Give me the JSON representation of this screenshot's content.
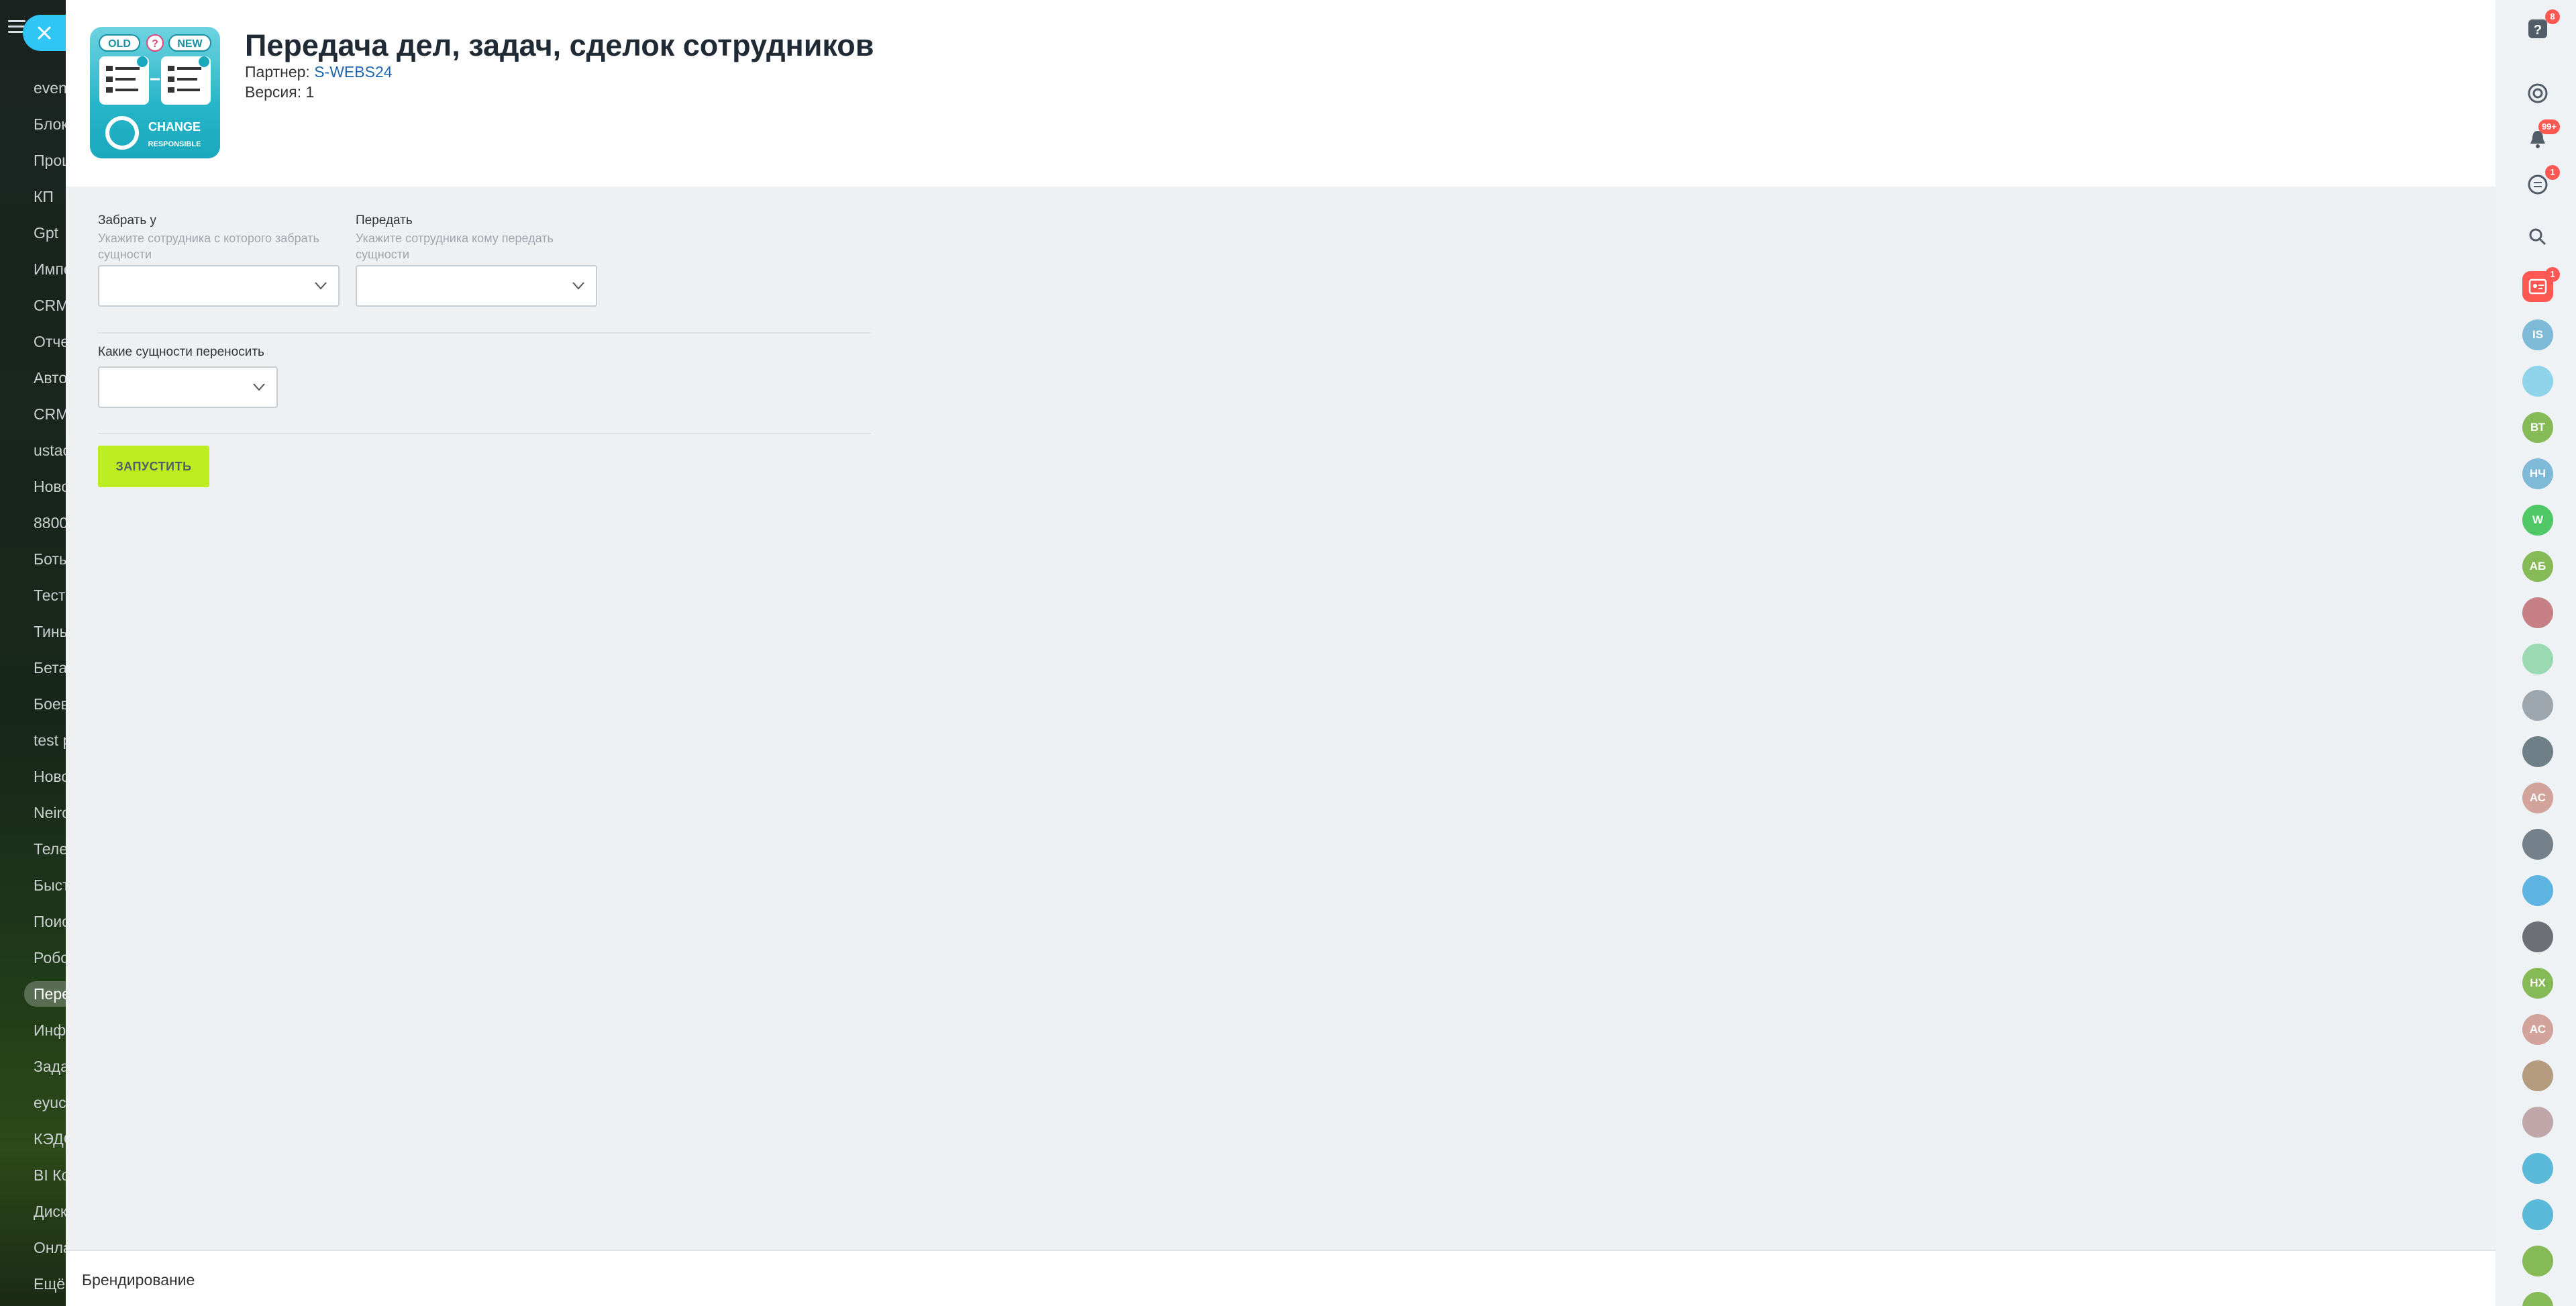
{
  "left_menu": {
    "items": [
      {
        "label": "events"
      },
      {
        "label": "Блоки"
      },
      {
        "label": "Процессы"
      },
      {
        "label": "КП"
      },
      {
        "label": "Gpt"
      },
      {
        "label": "Импорт"
      },
      {
        "label": "CRM"
      },
      {
        "label": "Отчеты"
      },
      {
        "label": "Автоматизация"
      },
      {
        "label": "CRM"
      },
      {
        "label": "ustack"
      },
      {
        "label": "Новости"
      },
      {
        "label": "8800"
      },
      {
        "label": "Боты"
      },
      {
        "label": "Тесты"
      },
      {
        "label": "Тиньков"
      },
      {
        "label": "Бета"
      },
      {
        "label": "Боевой"
      },
      {
        "label": "test p"
      },
      {
        "label": "Новое"
      },
      {
        "label": "Neiro"
      },
      {
        "label": "Телефония"
      },
      {
        "label": "Быстро"
      },
      {
        "label": "Поиск"
      },
      {
        "label": "Роботы"
      },
      {
        "label": "Передача",
        "active": true
      },
      {
        "label": "Информация"
      },
      {
        "label": "Задачи"
      },
      {
        "label": "eyuc"
      },
      {
        "label": "КЭДО"
      },
      {
        "label": "BI Конструктор"
      },
      {
        "label": "Диск"
      },
      {
        "label": "Онлайн"
      },
      {
        "label": "Ещё"
      }
    ]
  },
  "app": {
    "title": "Передача дел, задач, сделок сотрудников",
    "partner_label": "Партнер: ",
    "partner_name": "S-WEBS24",
    "version": "Версия: 1",
    "logo": {
      "old_tag": "OLD",
      "question": "?",
      "new_tag": "NEW",
      "change": "CHANGE",
      "responsible": "RESPONSIBLE"
    }
  },
  "form": {
    "from": {
      "label": "Забрать у",
      "hint": "Укажите сотрудника с которого забрать сущности",
      "value": ""
    },
    "to": {
      "label": "Передать",
      "hint": "Укажите сотрудника кому передать сущности",
      "value": ""
    },
    "entities": {
      "label": "Какие сущности переносить",
      "value": ""
    },
    "run_button": "ЗАПУСТИТЬ"
  },
  "footer": {
    "label": "Брендирование"
  },
  "right_bar": {
    "help_badge": "8",
    "notifications_badge": "99+",
    "messages_badge": "1",
    "contact_badge": "1",
    "avatars": [
      {
        "initials": "IS",
        "color": "#7fb9d8"
      },
      {
        "initials": "",
        "color": "#8fd3ea"
      },
      {
        "initials": "ВТ",
        "color": "#86ba57"
      },
      {
        "initials": "НЧ",
        "color": "#7fb9d8"
      },
      {
        "initials": "W",
        "color": "#4fc764"
      },
      {
        "initials": "АБ",
        "color": "#86ba57"
      },
      {
        "initials": "",
        "color": "#c77f86"
      },
      {
        "initials": "",
        "color": "#9ad9b1"
      },
      {
        "initials": "",
        "color": "#9ea6ad"
      },
      {
        "initials": "",
        "color": "#6f7f88"
      },
      {
        "initials": "АС",
        "color": "#d1a39a"
      },
      {
        "initials": "",
        "color": "#74808a"
      },
      {
        "initials": "",
        "color": "#5eb4e0"
      },
      {
        "initials": "",
        "color": "#6c6f75"
      },
      {
        "initials": "НХ",
        "color": "#86ba57"
      },
      {
        "initials": "АС",
        "color": "#d1a39a"
      },
      {
        "initials": "",
        "color": "#b59b7d"
      },
      {
        "initials": "",
        "color": "#c1a6a9"
      },
      {
        "initials": "",
        "color": "#5ab8d8"
      },
      {
        "initials": "",
        "color": "#5ab8d8"
      },
      {
        "initials": "",
        "color": "#86ba57"
      },
      {
        "initials": "",
        "color": "#86ba57"
      }
    ]
  }
}
